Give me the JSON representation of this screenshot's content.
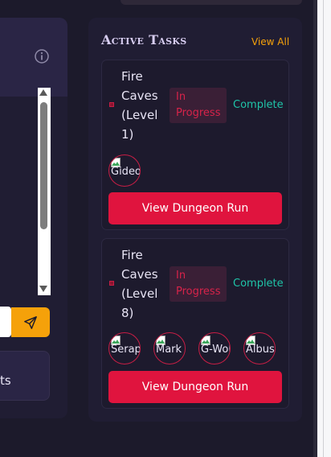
{
  "tasks_panel": {
    "title": "Active Tasks",
    "view_all_label": "View All",
    "tasks": [
      {
        "dungeon_name": "Fire Caves (Level 1)",
        "status": "In Progress",
        "complete_label": "Complete",
        "party_alts": [
          "Gideon"
        ],
        "action_label": "View Dungeon Run"
      },
      {
        "dungeon_name": "Fire Caves (Level 8)",
        "status": "In Progress",
        "complete_label": "Complete",
        "party_alts": [
          "Seraph",
          "Mark",
          "G-Wolf",
          "Albus"
        ],
        "action_label": "View Dungeon Run"
      }
    ]
  },
  "left_panel": {
    "stats_label_fragment": "ts",
    "info_icon": "info-circle-icon",
    "send_icon": "paper-plane-icon"
  },
  "colors": {
    "accent": "#f5a10a",
    "danger": "#e0143e",
    "success": "#1fc4a8",
    "panel": "#201d33"
  }
}
